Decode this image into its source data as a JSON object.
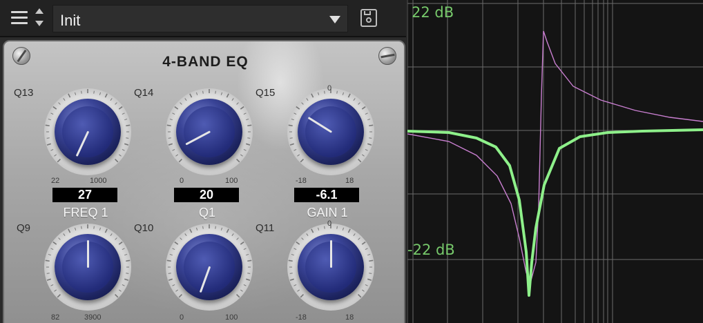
{
  "toolbar": {
    "menu_icon": "hamburger-menu-icon",
    "preset_name": "Init",
    "save_icon": "save-icon"
  },
  "panel": {
    "title": "4-BAND EQ",
    "knobs": [
      {
        "id": "Q13",
        "scale_min": "22",
        "scale_max": "1000",
        "value": "27",
        "label": "FREQ 1"
      },
      {
        "id": "Q14",
        "scale_min": "0",
        "scale_max": "100",
        "value": "20",
        "label": "Q1"
      },
      {
        "id": "Q15",
        "scale_top": "0",
        "scale_min": "-18",
        "scale_max": "18",
        "value": "-6.1",
        "label": "GAIN 1"
      },
      {
        "id": "Q9",
        "scale_min": "82",
        "scale_max": "3900"
      },
      {
        "id": "Q10",
        "scale_min": "0",
        "scale_max": "100"
      },
      {
        "id": "Q11",
        "scale_top": "0",
        "scale_min": "-18",
        "scale_max": "18"
      }
    ]
  },
  "graph": {
    "top_label": "22 dB",
    "bottom_label": "-22 dB",
    "colors": {
      "main": "#8ef08a",
      "secondary": "#c97fd0",
      "grid": "#6b6b6b",
      "label": "#77c96b"
    }
  }
}
